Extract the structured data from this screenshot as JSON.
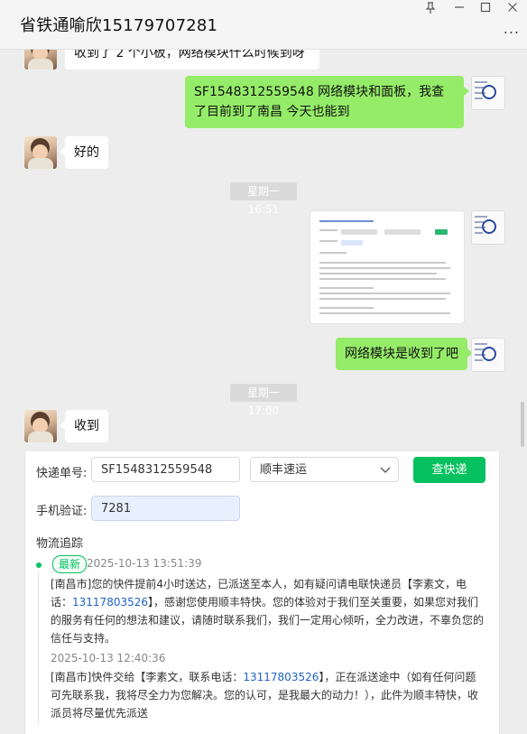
{
  "window": {
    "title": "省铁通喻欣15179707281",
    "pin_icon": "pin-icon",
    "minimize_icon": "minimize-icon",
    "maximize_icon": "maximize-icon",
    "close_icon": "close-icon",
    "more_label": "..."
  },
  "chat": {
    "faded_top_message": "收到了 2 个小板，网络模块什么时候到呀",
    "messages": [
      {
        "side": "right",
        "text": "SF1548312559548     网络模块和面板，我查了目前到了南昌  今天也能到"
      },
      {
        "side": "left",
        "text": "好的"
      },
      {
        "timestamp": "星期一 16:51"
      },
      {
        "side": "right",
        "type": "image"
      },
      {
        "side": "right",
        "text": "网络模块是收到了吧"
      },
      {
        "timestamp": "星期一 17:00"
      },
      {
        "side": "left",
        "text": "收到"
      }
    ],
    "msg1": "SF1548312559548     网络模块和面板，我查了目前到了南昌  今天也能到",
    "msg2": "好的",
    "ts1": "星期一 16:51",
    "msg3": "网络模块是收到了吧",
    "ts2": "星期一 17:00",
    "msg4": "收到"
  },
  "tracking": {
    "tracking_label": "快递单号:",
    "tracking_number": "SF1548312559548",
    "carrier": "顺丰速运",
    "query_button": "查快递",
    "phone_label": "手机验证:",
    "phone_value": "7281",
    "section_title": "物流追踪",
    "latest_tag": "最新",
    "events": [
      {
        "time": "2025-10-13 13:51:39",
        "text_pre": "[南昌市]您的快件提前4小时送达，已派送至本人，如有疑问请电联快递员【李素文，电话：",
        "phone": "13117803526",
        "text_post": "】，感谢您使用顺丰特快。您的体验对于我们至关重要，如果您对我们的服务有任何的想法和建议，请随时联系我们，我们一定用心倾听，全力改进，不辜负您的信任与支持。"
      },
      {
        "time": "2025-10-13 12:40:36",
        "text_pre": "[南昌市]快件交给【李素文，联系电话：",
        "phone": "13117803526",
        "text_post": "】，正在派送途中（如有任何问题可先联系我，我将尽全力为您解决。您的认可，是我最大的动力！），此件为顺丰特快，收派员将尽量优先派送"
      }
    ]
  },
  "colors": {
    "accent_green": "#07c160",
    "bubble_green": "#95ec69",
    "chat_bg": "#ededed",
    "link_blue": "#1f63c7"
  }
}
